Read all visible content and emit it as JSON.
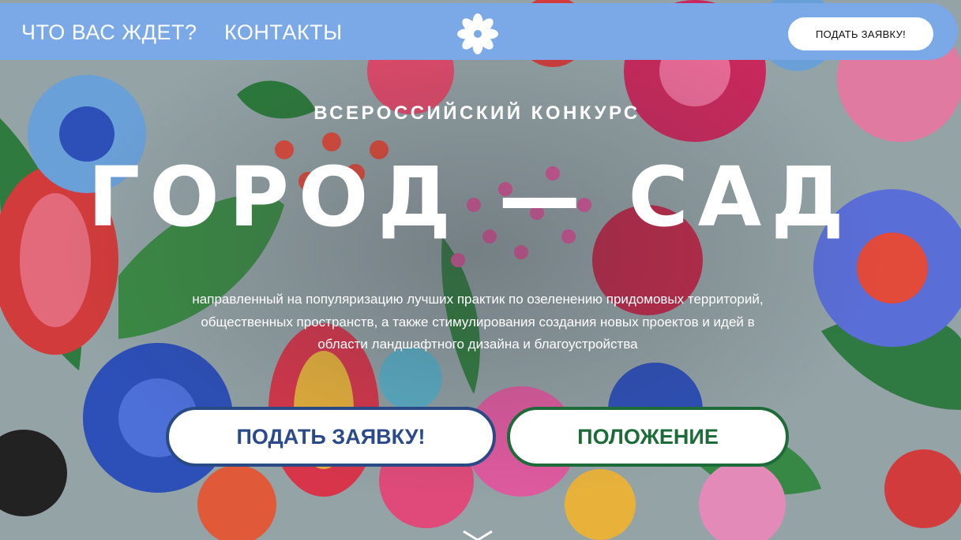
{
  "header": {
    "nav": [
      {
        "label": "ЧТО ВАС ЖДЕТ?"
      },
      {
        "label": "КОНТАКТЫ"
      }
    ],
    "logo_icon": "daisy-flower-icon",
    "cta_label": "ПОДАТЬ ЗАЯВКУ!"
  },
  "hero": {
    "kicker": "ВСЕРОССИЙСКИЙ КОНКУРС",
    "title": "ГОРОД — САД",
    "description": "направленный на популяризацию лучших практик по озеленению придомовых территорий, общественных пространств, а также стимулирования создания новых проектов и идей в области ландшафтного дизайна и благоустройства",
    "apply_button": "ПОДАТЬ ЗАЯВКУ!",
    "rules_button": "ПОЛОЖЕНИЕ",
    "scroll_icon": "chevron-down-icon"
  },
  "colors": {
    "header_bg": "#7ba8e6",
    "apply_accent": "#2b4a8a",
    "rules_accent": "#1e6b3a"
  }
}
